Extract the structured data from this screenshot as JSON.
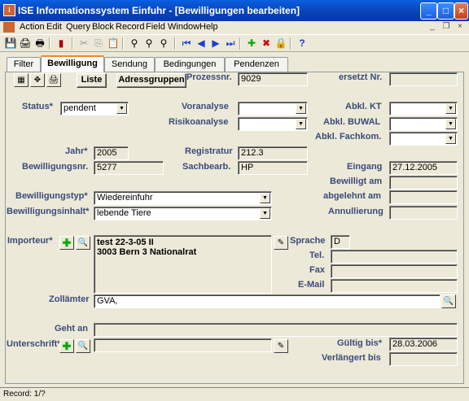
{
  "window": {
    "title": "ISE Informationssystem Einfuhr - [Bewilligungen bearbeiten]"
  },
  "menu": [
    "Action",
    "Edit",
    "Query",
    "Block",
    "Record",
    "Field",
    "Window",
    "Help"
  ],
  "tabs": [
    "Filter",
    "Bewilligung",
    "Sendung",
    "Bedingungen",
    "Pendenzen"
  ],
  "buttons": {
    "liste": "Liste",
    "adressgruppen": "Adressgruppen"
  },
  "labels": {
    "prozessnr": "Prozessnr.",
    "ersetzt": "ersetzt Nr.",
    "status": "Status*",
    "voranalyse": "Voranalyse",
    "risikoanalyse": "Risikoanalyse",
    "abkl_kt": "Abkl. KT",
    "abkl_buwal": "Abkl. BUWAL",
    "abkl_fachkom": "Abkl. Fachkom.",
    "jahr": "Jahr*",
    "registratur": "Registratur",
    "bewilligungsnr": "Bewilligungsnr.",
    "sachbearb": "Sachbearb.",
    "eingang": "Eingang",
    "bewilligt_am": "Bewilligt am",
    "bewilligungstyp": "Bewilligungstyp*",
    "abgelehnt_am": "abgelehnt am",
    "bewilligungsinhalt": "Bewilligungsinhalt*",
    "annullierung": "Annullierung",
    "importeur": "Importeur*",
    "sprache": "Sprache",
    "tel": "Tel.",
    "fax": "Fax",
    "email": "E-Mail",
    "zollaemter": "Zollämter",
    "geht_an": "Geht an",
    "unterschrift": "Unterschrift*",
    "gueltig_bis": "Gültig bis*",
    "verlaengert_bis": "Verlängert bis"
  },
  "values": {
    "prozessnr": "9029",
    "status": "pendent",
    "jahr": "2005",
    "registratur": "212.3",
    "bewilligungsnr": "5277",
    "sachbearb": "HP",
    "eingang": "27.12.2005",
    "bewilligungstyp": "Wiedereinfuhr",
    "bewilligungsinhalt": "lebende Tiere",
    "importeur_line1": "test 22-3-05  II",
    "importeur_line2": "3003 Bern 3 Nationalrat",
    "sprache": "D",
    "zollaemter": "GVA,",
    "gueltig_bis": "28.03.2006"
  },
  "statusbar": {
    "record": "Record: 1/?"
  }
}
